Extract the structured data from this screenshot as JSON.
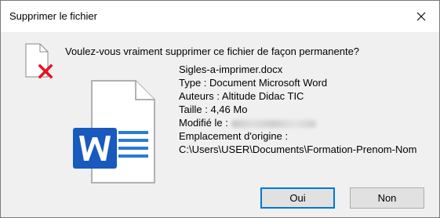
{
  "dialog": {
    "title": "Supprimer le fichier",
    "close_icon": "close-icon",
    "question": "Voulez-vous vraiment supprimer ce fichier de façon permanente?"
  },
  "file": {
    "name": "Sigles-a-imprimer.docx",
    "type": "Type : Document Microsoft Word",
    "authors": "Auteurs : Altitude Didac TIC",
    "size": "Taille : 4,46 Mo",
    "modified_label": "Modifié le :",
    "location_label": "Emplacement d'origine :",
    "location": "C:\\Users\\USER\\Documents\\Formation-Prenom-Nom",
    "icon": "word-document-icon"
  },
  "buttons": {
    "yes": "Oui",
    "no": "Non"
  },
  "colors": {
    "accent": "#0078d7",
    "word_blue": "#185abd",
    "delete_red": "#e81123"
  }
}
